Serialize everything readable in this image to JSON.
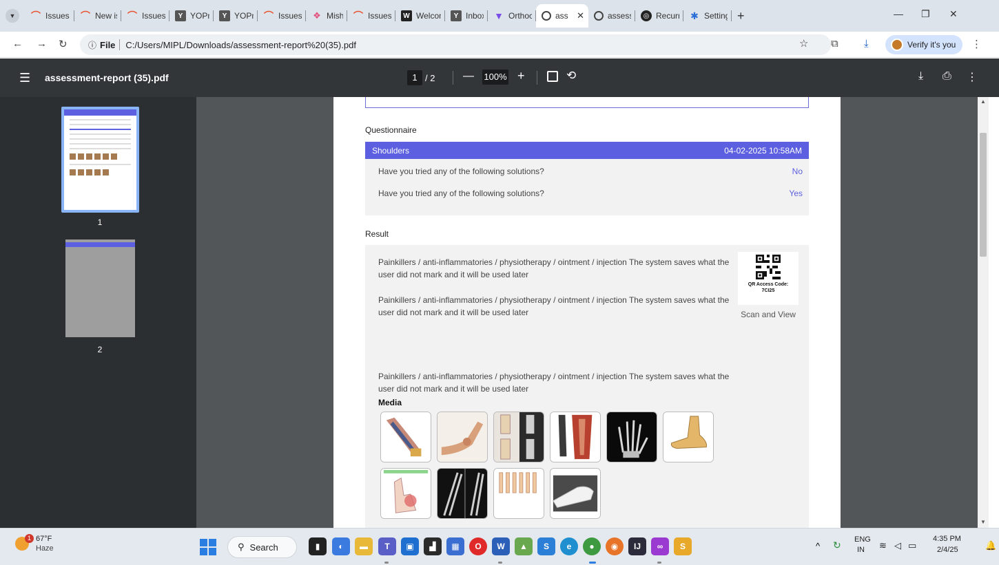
{
  "browser": {
    "tabs": [
      {
        "title": "Issues -",
        "favicon": "fav-orange",
        "glyph": "⌒"
      },
      {
        "title": "New iss",
        "favicon": "fav-orange",
        "glyph": "⌒"
      },
      {
        "title": "Issues -",
        "favicon": "fav-orange",
        "glyph": "⌒"
      },
      {
        "title": "YOPma",
        "favicon": "fav-yop",
        "glyph": "Y"
      },
      {
        "title": "YOPma",
        "favicon": "fav-yop",
        "glyph": "Y"
      },
      {
        "title": "Issues -",
        "favicon": "fav-orange",
        "glyph": "⌒"
      },
      {
        "title": "Misha",
        "favicon": "fav-misha",
        "glyph": "❖"
      },
      {
        "title": "Issues -",
        "favicon": "fav-orange",
        "glyph": "⌒"
      },
      {
        "title": "Welcon",
        "favicon": "fav-welcome",
        "glyph": "W"
      },
      {
        "title": "Inbox",
        "favicon": "fav-yop",
        "glyph": "Y"
      },
      {
        "title": "Orthoc",
        "favicon": "fav-ortho",
        "glyph": "▼"
      },
      {
        "title": "ass",
        "favicon": "fav-globe",
        "glyph": "",
        "active": true
      },
      {
        "title": "assessn",
        "favicon": "fav-globe",
        "glyph": ""
      },
      {
        "title": "Recurri",
        "favicon": "fav-recur",
        "glyph": "◎"
      },
      {
        "title": "Setting",
        "favicon": "fav-gear",
        "glyph": "✱"
      }
    ],
    "address": {
      "scheme": "File",
      "url": "C:/Users/MIPL/Downloads/assessment-report%20(35).pdf"
    },
    "verify_label": "Verify it's you"
  },
  "pdf": {
    "title": "assessment-report (35).pdf",
    "current_page": "1",
    "total_pages": "/ 2",
    "zoom": "100%",
    "thumbnails": [
      "1",
      "2"
    ]
  },
  "report": {
    "questionnaire": {
      "heading": "Questionnaire",
      "section": "Shoulders",
      "datetime": "04-02-2025 10:58AM",
      "rows": [
        {
          "question": "Have you tried any of the following solutions?",
          "answer": "No"
        },
        {
          "question": "Have you tried any of the following solutions?",
          "answer": "Yes"
        }
      ]
    },
    "result": {
      "heading": "Result",
      "paragraphs": [
        "Painkillers / anti-inflammatories / physiotherapy / ointment / injection The system saves what the user did not mark and it will be used later",
        "Painkillers / anti-inflammatories / physiotherapy / ointment / injection The system saves what the user did not mark and it will be used later",
        "Painkillers / anti-inflammatories / physiotherapy / ointment / injection The system saves what the user did not mark and it will be used later"
      ],
      "qr_label_line1": "QR Access Code:",
      "qr_label_line2": "7CI25",
      "scan_view": "Scan and View",
      "media_label": "Media"
    }
  },
  "taskbar": {
    "weather_badge": "1",
    "temperature": "67°F",
    "condition": "Haze",
    "search_label": "Search",
    "lang_line1": "ENG",
    "lang_line2": "IN",
    "time": "4:35 PM",
    "date": "2/4/25"
  },
  "colors": {
    "accent": "#5c5fe0",
    "pdf_toolbar": "#323639",
    "pdf_background": "#525659"
  }
}
